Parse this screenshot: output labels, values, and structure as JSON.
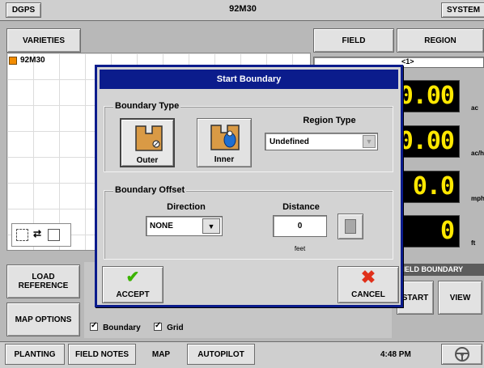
{
  "topbar": {
    "left_label": "DGPS",
    "title": "92M30",
    "right_label": "SYSTEM"
  },
  "left_panel": {
    "varieties_label": "VARIETIES",
    "variety_item": "92M30",
    "variety_color": "#f28c00"
  },
  "right_panel": {
    "field_label": "FIELD",
    "region_label": "REGION",
    "region_value": "<1>",
    "readouts": [
      {
        "value": "0.00",
        "unit": "ac"
      },
      {
        "value": "0.00",
        "unit": "ac/h"
      },
      {
        "value": "0.0",
        "unit": "mph"
      },
      {
        "value": "0",
        "unit": "ft"
      }
    ],
    "field_boundary_header": "FIELD BOUNDARY",
    "start_label": "START",
    "view_label": "VIEW"
  },
  "options": {
    "load_reference_label": "LOAD REFERENCE",
    "map_options_label": "MAP OPTIONS",
    "boundary_label": "Boundary",
    "grid_label": "Grid"
  },
  "dialog": {
    "title": "Start Boundary",
    "boundary_type_label": "Boundary Type",
    "outer_label": "Outer",
    "inner_label": "Inner",
    "region_type_label": "Region Type",
    "region_type_value": "Undefined",
    "boundary_offset_label": "Boundary Offset",
    "direction_label": "Direction",
    "direction_value": "NONE",
    "distance_label": "Distance",
    "distance_value": "0",
    "distance_unit": "feet",
    "accept_label": "ACCEPT",
    "cancel_label": "CANCEL"
  },
  "bottombar": {
    "tabs": [
      "PLANTING",
      "FIELD NOTES",
      "MAP",
      "AUTOPILOT"
    ],
    "time": "4:48 PM"
  },
  "colors": {
    "dialog_blue": "#0b1c8c",
    "readout_yellow": "#ffe800",
    "accept_green": "#3bb300",
    "cancel_red": "#e0301a",
    "tool_orange": "#d99a45"
  }
}
